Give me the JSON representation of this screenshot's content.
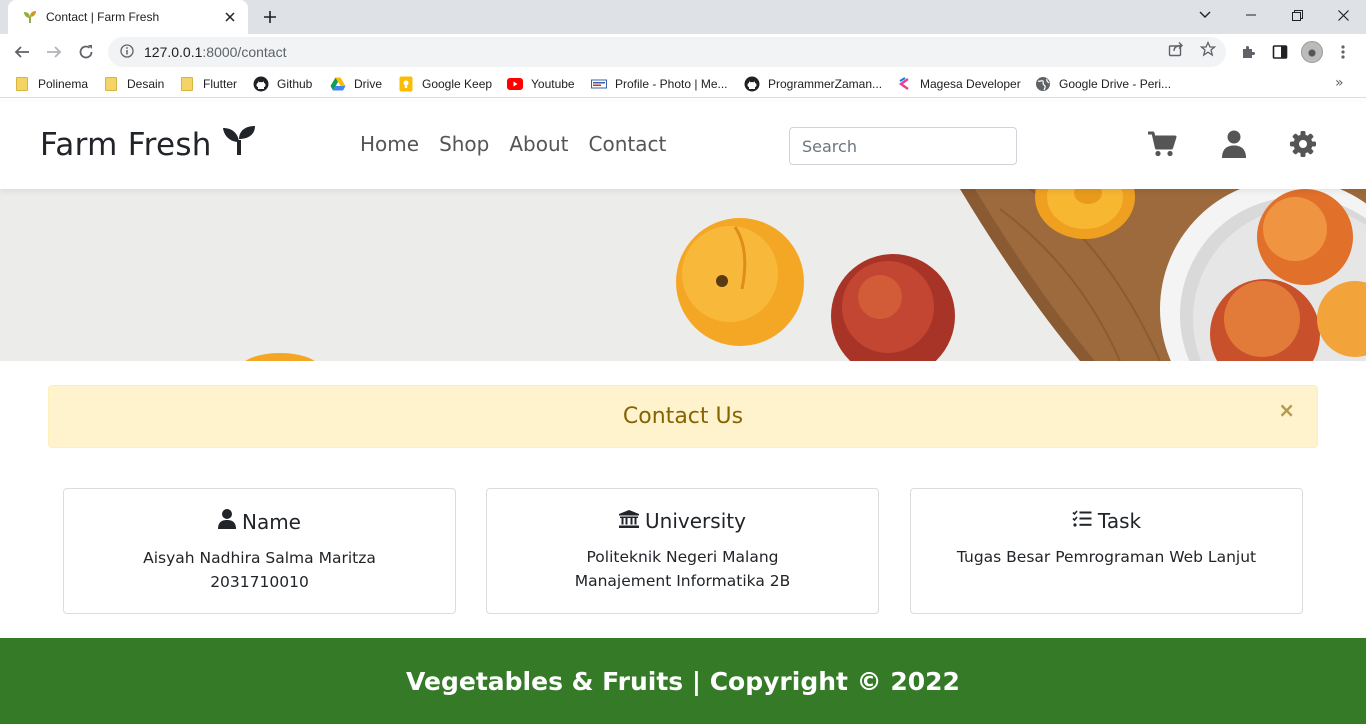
{
  "browser": {
    "tab_title": "Contact | Farm Fresh",
    "url_host": "127.0.0.1",
    "url_path": ":8000/contact",
    "bookmarks": [
      "Polinema",
      "Desain",
      "Flutter",
      "Github",
      "Drive",
      "Google Keep",
      "Youtube",
      "Profile - Photo | Me...",
      "ProgrammerZaman...",
      "Magesa Developer",
      "Google Drive - Peri..."
    ]
  },
  "nav": {
    "brand": "Farm Fresh",
    "links": [
      "Home",
      "Shop",
      "About",
      "Contact"
    ],
    "search_placeholder": "Search"
  },
  "alert": {
    "title": "Contact Us",
    "close": "×"
  },
  "cards": [
    {
      "title": "Name",
      "lines": [
        "Aisyah Nadhira Salma Maritza",
        "2031710010"
      ],
      "icon": "user-icon"
    },
    {
      "title": "University",
      "lines": [
        "Politeknik Negeri Malang",
        "Manajement Informatika 2B"
      ],
      "icon": "university-icon"
    },
    {
      "title": "Task",
      "lines": [
        "Tugas Besar Pemrograman Web Lanjut"
      ],
      "icon": "tasks-icon"
    }
  ],
  "footer": {
    "text": "Vegetables & Fruits | Copyright © 2022"
  },
  "colors": {
    "footer_bg": "#357a27",
    "alert_bg": "#fff3cd",
    "alert_text": "#856404"
  }
}
